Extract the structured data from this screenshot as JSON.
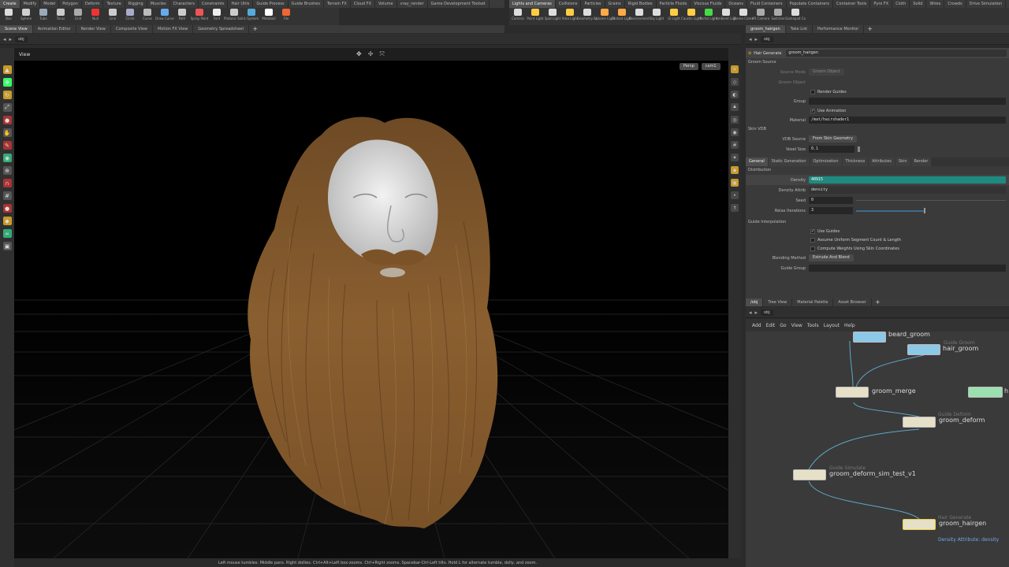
{
  "shelf_left": {
    "tabs": [
      "Create",
      "Modify",
      "Model",
      "Polygon",
      "Deform",
      "Texture",
      "Rigging",
      "Muscles",
      "Characters",
      "Constraints",
      "Hair Utils",
      "Guide Process",
      "Guide Brushes",
      "Terrain FX",
      "Cloud FX",
      "Volume",
      "vray_render",
      "Game Development Toolset"
    ],
    "active_tab": 0,
    "tools": [
      "Box",
      "Sphere",
      "Tube",
      "Torus",
      "Grid",
      "Null",
      "Line",
      "Circle",
      "Curve",
      "Draw Curve",
      "Path",
      "Spray Paint",
      "Font",
      "Platonic Solids",
      "L-System",
      "Metaball",
      "File"
    ]
  },
  "shelf_right": {
    "tabs": [
      "Lights and Cameras",
      "Collisions",
      "Particles",
      "Grains",
      "Rigid Bodies",
      "Particle Fluids",
      "Viscous Fluids",
      "Oceans",
      "Fluid Containers",
      "Populate Containers",
      "Container Tools",
      "Pyro FX",
      "Cloth",
      "Solid",
      "Wires",
      "Crowds",
      "Drive Simulation",
      "New Shelf",
      "vray_render"
    ],
    "active_tab": 0,
    "tools": [
      "Camera",
      "Point Light",
      "Spot Light",
      "Area Light",
      "Geometry Light",
      "Volume Light",
      "Distant Light",
      "Environment Light",
      "Sky Light",
      "GI Light",
      "Caustic Light",
      "Portal Light",
      "Ambient Light",
      "Stereo Camera",
      "VR Camera",
      "Switcher",
      "Gamepad Camera"
    ]
  },
  "left_panes": [
    "Scene View",
    "Animation Editor",
    "Render View",
    "Composite View",
    "Motion FX View",
    "Geometry Spreadsheet"
  ],
  "right_top_panes": [
    "groom_hairgen",
    "Take List",
    "Performance Monitor"
  ],
  "right_bottom_panes": [
    "/obj",
    "Tree View",
    "Material Palette",
    "Asset Browser"
  ],
  "path": "obj",
  "viewport": {
    "title": "View",
    "persp": "Persp",
    "cam": "cam1",
    "status": "Left mouse tumbles. Middle pans. Right dollies. Ctrl+Alt+Left box-zooms. Ctrl+Right zooms. Spacebar-Ctrl-Left tilts. Hold L for alternate tumble, dolly, and zoom."
  },
  "params": {
    "node_type": "Hair Generate",
    "node_name": "groom_hairgen",
    "groom_source": "Groom Source",
    "source_mode_label": "Source Mode",
    "source_mode_value": "Groom Object",
    "groom_object_label": "Groom Object",
    "render_guides": "Render Guides",
    "group_label": "Group",
    "use_animation": "Use Animation",
    "material_label": "Material",
    "material_value": "/mat/hairshader1",
    "skin_vdb": "Skin VDB",
    "vdb_source_label": "VDB Source",
    "vdb_source_value": "From Skin Geometry",
    "voxel_size_label": "Voxel Size",
    "voxel_size_value": "0.1",
    "tabs": [
      "General",
      "Static Generation",
      "Optimization",
      "Thickness",
      "Attributes",
      "Skin",
      "Render"
    ],
    "distribution": "Distribution",
    "density_label": "Density",
    "density_value": "40915",
    "density_attrib_label": "Density Attrib",
    "density_attrib_value": "density",
    "seed_label": "Seed",
    "seed_value": "0",
    "relax_label": "Relax Iterations",
    "relax_value": "3",
    "guide_interp": "Guide Interpolation",
    "use_guides": "Use Guides",
    "assume_uniform": "Assume Uniform Segment Count & Length",
    "compute_weights": "Compute Weights Using Skin Coordinates",
    "blending_label": "Blending Method",
    "blending_value": "Extrude And Blend",
    "guide_group_label": "Guide Group"
  },
  "network": {
    "menu": [
      "Add",
      "Edit",
      "Go",
      "View",
      "Tools",
      "Layout",
      "Help"
    ],
    "nodes": [
      {
        "name": "beard_groom",
        "type": ""
      },
      {
        "name": "hair_groom",
        "type": "Guide Groom"
      },
      {
        "name": "groom_merge",
        "type": ""
      },
      {
        "name": "h",
        "type": ""
      },
      {
        "name": "groom_deform",
        "type": "Guide Deform"
      },
      {
        "name": "groom_deform_sim_test_v1",
        "type": "Guide Simulate"
      },
      {
        "name": "groom_hairgen",
        "type": "Hair Generate"
      }
    ],
    "info": "Density Attribute: density"
  }
}
